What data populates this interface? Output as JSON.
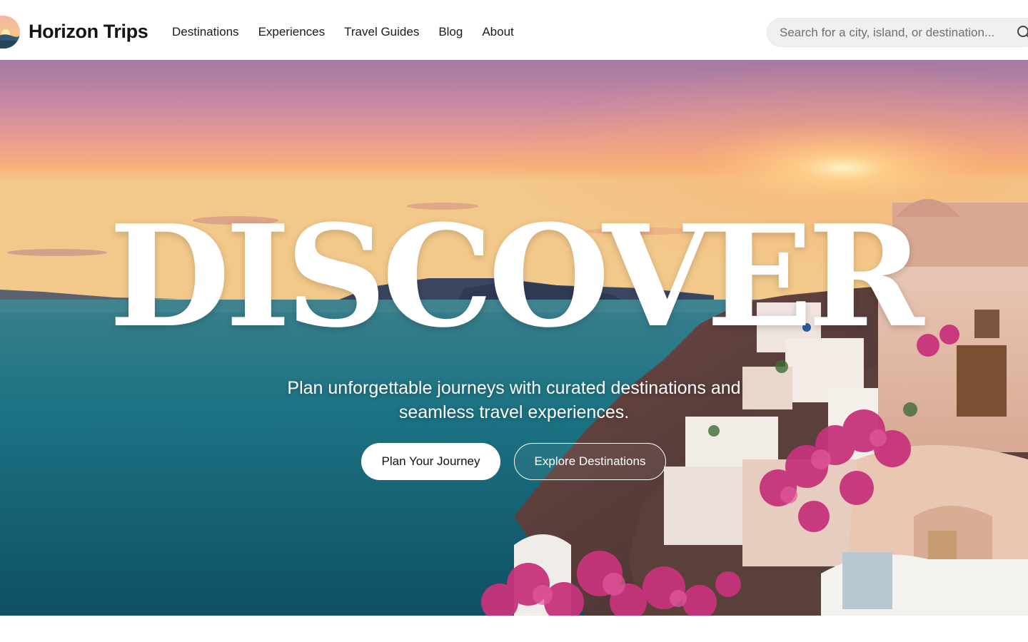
{
  "brand": {
    "name": "Horizon Trips",
    "logo_icon": "sunset-logo-icon"
  },
  "nav": {
    "items": [
      {
        "label": "Destinations"
      },
      {
        "label": "Experiences"
      },
      {
        "label": "Travel Guides"
      },
      {
        "label": "Blog"
      },
      {
        "label": "About"
      }
    ]
  },
  "search": {
    "placeholder": "Search for a city, island, or destination...",
    "value": "",
    "icon": "search-icon"
  },
  "hero": {
    "title": "DISCOVER",
    "subtitle": "Plan unforgettable journeys with curated destinations and seamless travel experiences.",
    "primary_cta": "Plan Your Journey",
    "secondary_cta": "Explore Destinations",
    "background": "hero-photo-santorini-sunset"
  },
  "colors": {
    "text_dark": "#141414",
    "search_bg": "#f0f0f1",
    "sea": "#1e6f7e",
    "sky_top": "#b07ca3",
    "sky_horizon": "#f5a567"
  }
}
